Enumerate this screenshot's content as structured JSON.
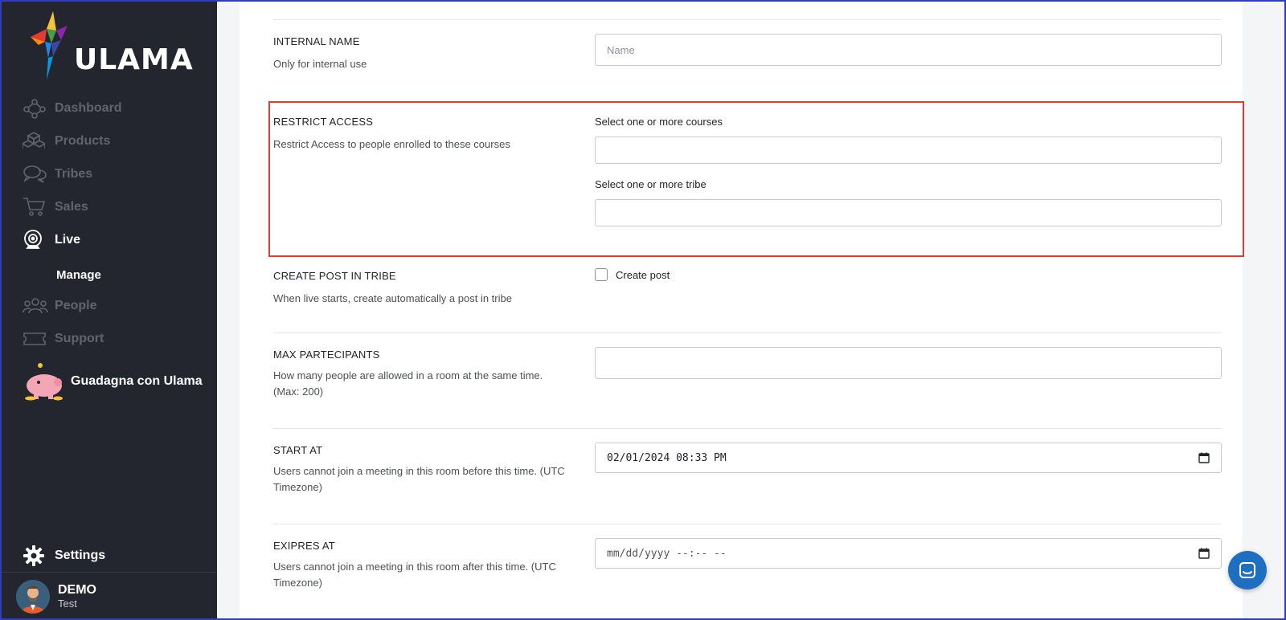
{
  "brand": {
    "name": "ULAMA",
    "accent_color": "#e53935",
    "sidebar_bg": "#23252f"
  },
  "sidebar": {
    "items": [
      {
        "label": "Dashboard",
        "icon": "network-icon",
        "active": false
      },
      {
        "label": "Products",
        "icon": "boxes-icon",
        "active": false
      },
      {
        "label": "Tribes",
        "icon": "chat-bubbles-icon",
        "active": false
      },
      {
        "label": "Sales",
        "icon": "cart-icon",
        "active": false
      },
      {
        "label": "Live",
        "icon": "webcam-icon",
        "active": true
      },
      {
        "label": "People",
        "icon": "people-icon",
        "active": false
      },
      {
        "label": "Support",
        "icon": "ticket-icon",
        "active": false
      }
    ],
    "sub_item": "Manage",
    "promo_label": "Guadagna con Ulama",
    "settings_label": "Settings",
    "user": {
      "name": "DEMO",
      "role": "Test"
    }
  },
  "form": {
    "internal_name": {
      "label": "INTERNAL NAME",
      "description": "Only for internal use",
      "placeholder": "Name",
      "value": ""
    },
    "restrict_access": {
      "label": "RESTRICT ACCESS",
      "description": "Restrict Access to people enrolled to these courses",
      "courses_label": "Select one or more courses",
      "tribe_label": "Select one or more tribe"
    },
    "create_post": {
      "label": "CREATE POST IN TRIBE",
      "description": "When live starts, create automatically a post in tribe",
      "checkbox_label": "Create post",
      "checked": false
    },
    "max_participants": {
      "label": "MAX PARTECIPANTS",
      "description": "How many people are allowed in a room at the same time. (Max: 200)",
      "value": ""
    },
    "start_at": {
      "label": "START AT",
      "description": "Users cannot join a meeting in this room before this time. (UTC Timezone)",
      "value": "02/01/2024 08:33 PM"
    },
    "expires_at": {
      "label": "EXIPRES AT",
      "description": "Users cannot join a meeting in this room after this time. (UTC Timezone)",
      "value": "mm/dd/yyyy --:-- --"
    }
  }
}
